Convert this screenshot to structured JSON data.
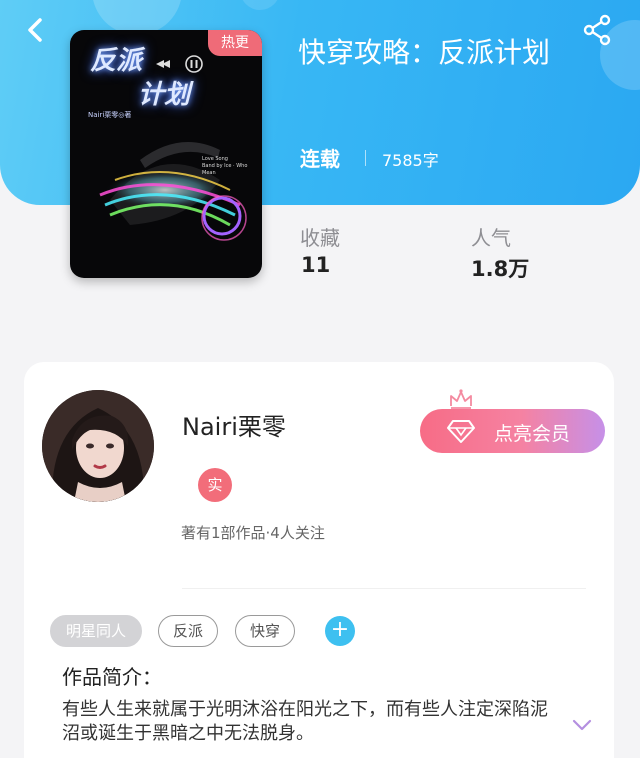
{
  "nav": {
    "back_icon": "chevron-left-icon",
    "share_icon": "share-icon"
  },
  "book": {
    "cover": {
      "title_line1": "反派",
      "title_line2": "计划",
      "author_small": "Nairi栗零◎著",
      "badge": "热更",
      "song_title": "Love Song",
      "song_sub": "Band by Ice · Who Mean"
    },
    "title": "快穿攻略：反派计划",
    "status": "连载",
    "word_count": "7585字",
    "stats": [
      {
        "label": "收藏",
        "value": "11"
      },
      {
        "label": "人气",
        "value": "1.8万"
      }
    ]
  },
  "author": {
    "name": "Nairi栗零",
    "verified_badge": "实",
    "meta": "著有1部作品·4人关注",
    "vip_button": "点亮会员"
  },
  "tags": {
    "filled": "明星同人",
    "outlined": [
      "反派",
      "快穿"
    ],
    "add": "+"
  },
  "intro": {
    "label": "作品简介：",
    "text": "有些人生来就属于光明沐浴在阳光之下，而有些人注定深陷泥沼或诞生于黑暗之中无法脱身。"
  },
  "colors": {
    "header_blue": "#38b7f4",
    "badge_red": "#ef6b78",
    "vip_gradient_start": "#f76c86",
    "vip_gradient_end": "#c690e8",
    "add_blue": "#3ec0f0"
  }
}
